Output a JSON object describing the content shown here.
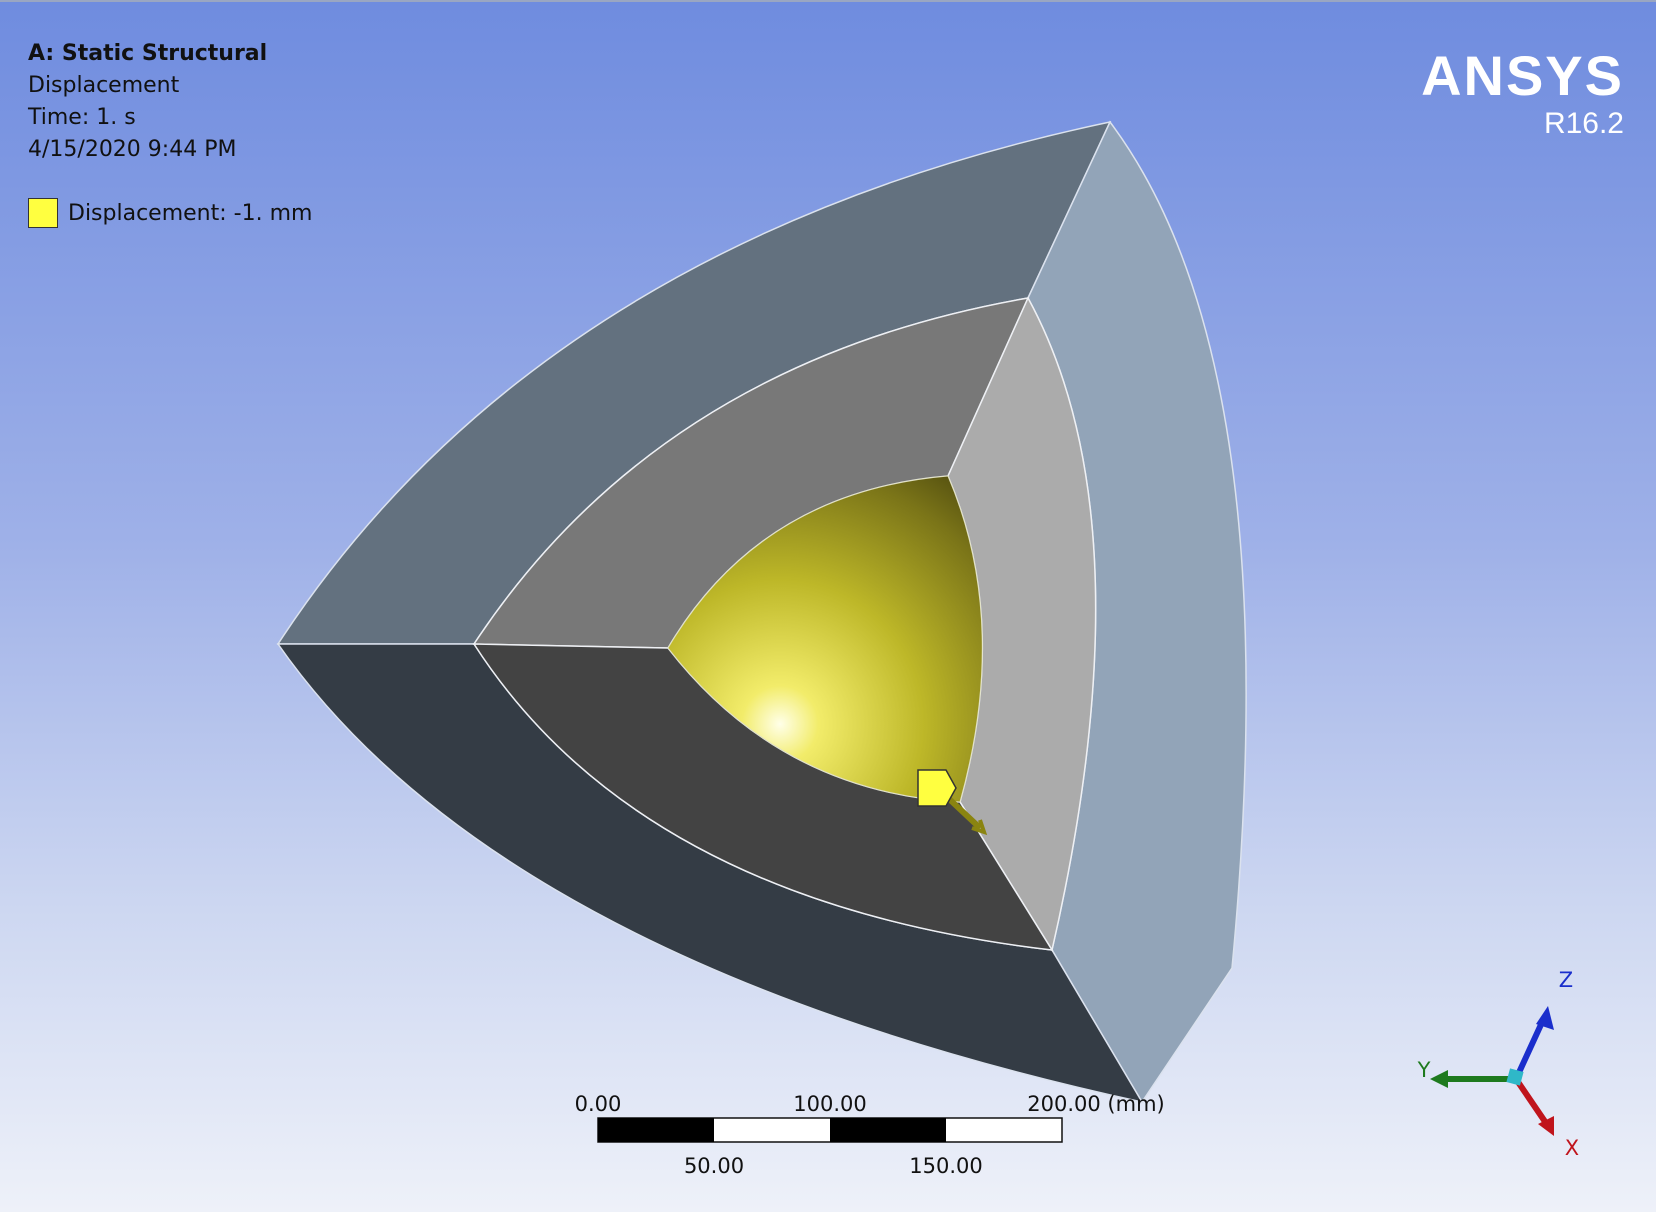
{
  "analysis": {
    "title": "A: Static Structural",
    "result": "Displacement",
    "time": "Time: 1. s",
    "date": "4/15/2020 9:44 PM"
  },
  "legend": {
    "label": "Displacement: -1. mm",
    "color": "#ffff40"
  },
  "brand": {
    "name": "ANSYS",
    "version": "R16.2"
  },
  "scale_bar": {
    "top_labels": [
      "0.00",
      "100.00",
      "200.00 (mm)"
    ],
    "bottom_labels": [
      "50.00",
      "150.00"
    ]
  },
  "triad": {
    "x": "X",
    "y": "Y",
    "z": "Z",
    "colors": {
      "x": "#c0141c",
      "y": "#1e7a1e",
      "z": "#1a2ecc",
      "origin": "#2fb8c8"
    }
  },
  "model": {
    "faces": {
      "outer_top": "#63717f",
      "outer_right": "#92a4b8",
      "outer_bottom": "#343c45",
      "mid_top": "#787878",
      "mid_right": "#ababab",
      "mid_bottom": "#434343",
      "inner_surface": "#c8c22a"
    },
    "load_marker": "displacement-marker"
  }
}
